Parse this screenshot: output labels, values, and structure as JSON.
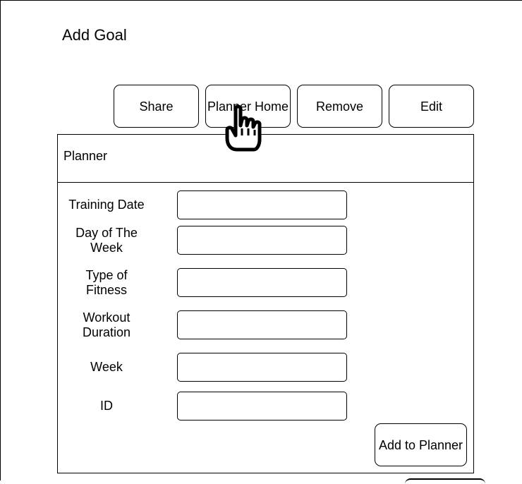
{
  "page": {
    "title": "Add Goal"
  },
  "toolbar": {
    "share_label": "Share",
    "planner_home_label": "Planner Home",
    "remove_label": "Remove",
    "edit_label": "Edit"
  },
  "planner": {
    "title": "Planner",
    "fields": [
      {
        "label": "Training Date",
        "value": "",
        "placeholder": ""
      },
      {
        "label": "Day of The Week",
        "value": "",
        "placeholder": ""
      },
      {
        "label": "Type of Fitness",
        "value": "",
        "placeholder": ""
      },
      {
        "label": "Workout Duration",
        "value": "",
        "placeholder": ""
      },
      {
        "label": "Week",
        "value": "",
        "placeholder": ""
      },
      {
        "label": "ID",
        "value": "",
        "placeholder": ""
      }
    ],
    "add_label": "Add to Planner"
  },
  "cursor": {
    "icon": "hand-pointer-icon"
  }
}
